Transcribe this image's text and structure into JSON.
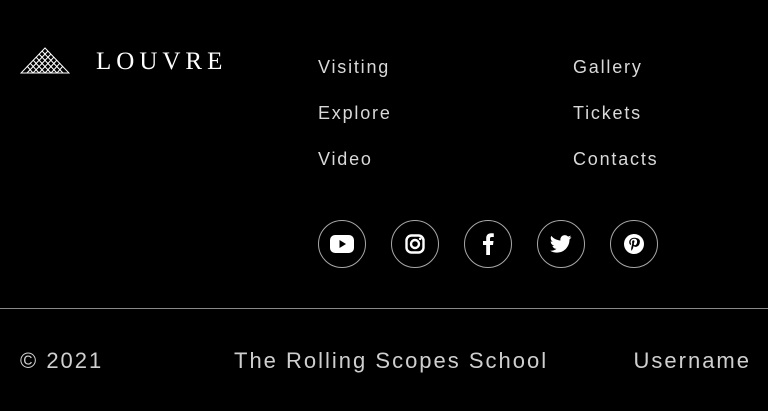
{
  "logo": {
    "text": "LOUVRE",
    "icon": "louvre-pyramid-icon"
  },
  "nav": {
    "left": [
      {
        "label": "Visiting"
      },
      {
        "label": "Explore"
      },
      {
        "label": "Video"
      }
    ],
    "right": [
      {
        "label": "Gallery"
      },
      {
        "label": "Tickets"
      },
      {
        "label": "Contacts"
      }
    ]
  },
  "socials": [
    {
      "icon": "youtube-icon"
    },
    {
      "icon": "instagram-icon"
    },
    {
      "icon": "facebook-icon"
    },
    {
      "icon": "twitter-icon"
    },
    {
      "icon": "pinterest-icon"
    }
  ],
  "footer": {
    "copyright": "© 2021",
    "school": "The Rolling Scopes School",
    "username": "Username"
  },
  "colors": {
    "background": "#000000",
    "text": "#d9d9d9",
    "border": "#a8a8a8"
  }
}
